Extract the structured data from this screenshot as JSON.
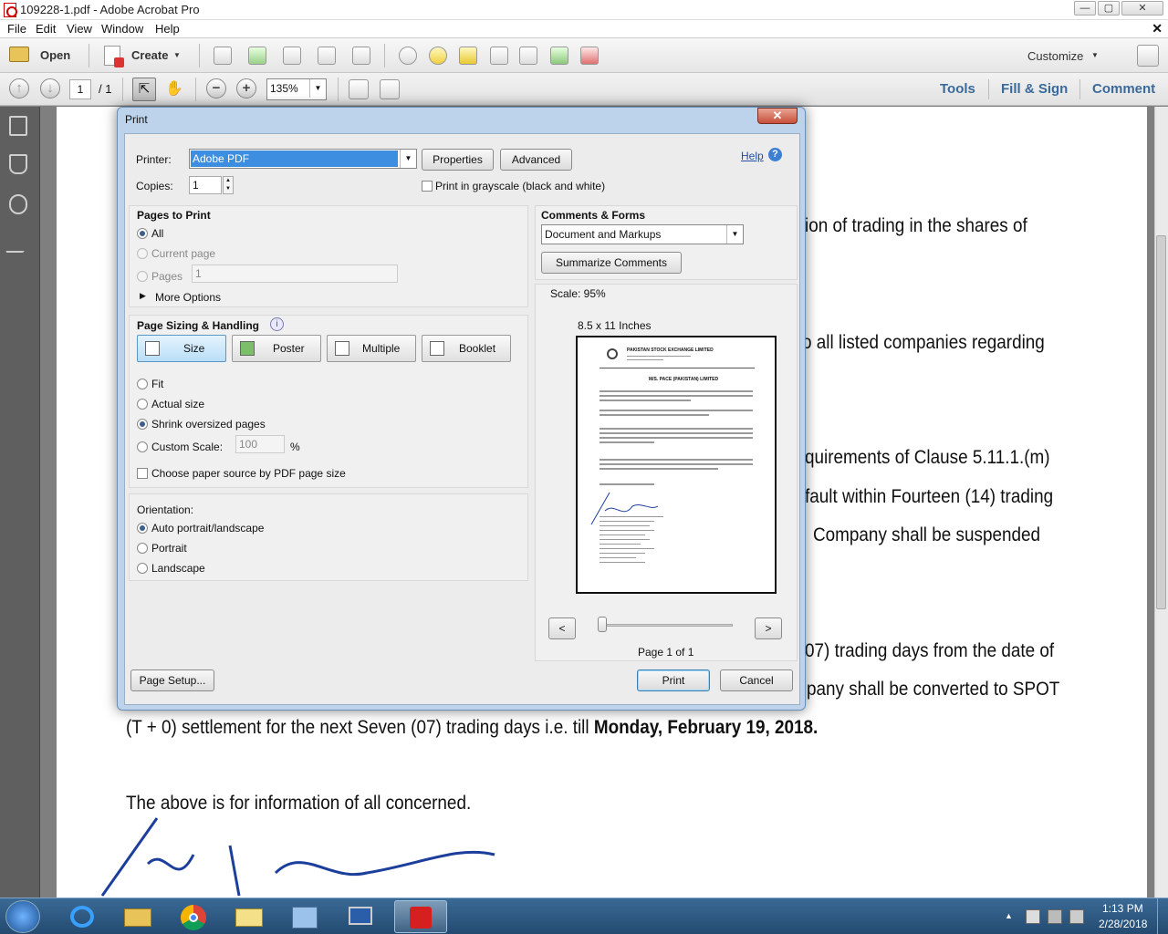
{
  "window": {
    "title": "109228-1.pdf - Adobe Acrobat Pro",
    "min": "—",
    "max": "▢",
    "close": "✕"
  },
  "menu": [
    "File",
    "Edit",
    "View",
    "Window",
    "Help"
  ],
  "toolbar": {
    "open": "Open",
    "create": "Create",
    "customize": "Customize"
  },
  "nav": {
    "page_current": "1",
    "page_total": "/ 1",
    "zoom": "135%"
  },
  "tabs": {
    "tools": "Tools",
    "fill_sign": "Fill & Sign",
    "comment": "Comment"
  },
  "document": {
    "lines": [
      "ion of trading in the shares of",
      "o all listed companies regarding",
      "quirements of Clause 5.11.1.(m)",
      "fault within Fourteen (14) trading",
      "Company  shall be suspended",
      "07) trading days from the date of",
      "pany shall be converted to SPOT",
      "(T + 0) settlement for the next Seven (07) trading days i.e. till ",
      "The above is for information of all concerned."
    ],
    "bold_tail": "Monday, February 19, 2018."
  },
  "dialog": {
    "title": "Print",
    "close": "✕",
    "printer_label": "Printer:",
    "printer_value": "Adobe PDF",
    "properties": "Properties",
    "advanced": "Advanced",
    "help": "Help",
    "copies_label": "Copies:",
    "copies_value": "1",
    "grayscale": "Print in grayscale (black and white)",
    "pages_to_print": {
      "heading": "Pages to Print",
      "all": "All",
      "current_page": "Current page",
      "pages": "Pages",
      "pages_value": "1",
      "more_options": "More Options"
    },
    "sizing": {
      "heading": "Page Sizing & Handling",
      "buttons": [
        "Size",
        "Poster",
        "Multiple",
        "Booklet"
      ],
      "fit": "Fit",
      "actual_size": "Actual size",
      "shrink": "Shrink oversized pages",
      "custom_scale": "Custom Scale:",
      "custom_scale_value": "100",
      "percent": "%",
      "paper_source": "Choose paper source by PDF page size"
    },
    "orientation": {
      "heading": "Orientation:",
      "auto": "Auto portrait/landscape",
      "portrait": "Portrait",
      "landscape": "Landscape"
    },
    "comments_forms": {
      "heading": "Comments & Forms",
      "value": "Document and Markups",
      "summarize": "Summarize Comments"
    },
    "preview": {
      "scale": "Scale:  95%",
      "paper": "8.5 x 11 Inches",
      "prev": "<",
      "next": ">",
      "page_info": "Page 1 of 1",
      "doc_header": "PAKISTAN STOCK EXCHANGE LIMITED",
      "doc_title": "M/S. PACE (PAKISTAN) LIMITED"
    },
    "page_setup": "Page Setup...",
    "print": "Print",
    "cancel": "Cancel"
  },
  "taskbar": {
    "time": "1:13 PM",
    "date": "2/28/2018"
  }
}
